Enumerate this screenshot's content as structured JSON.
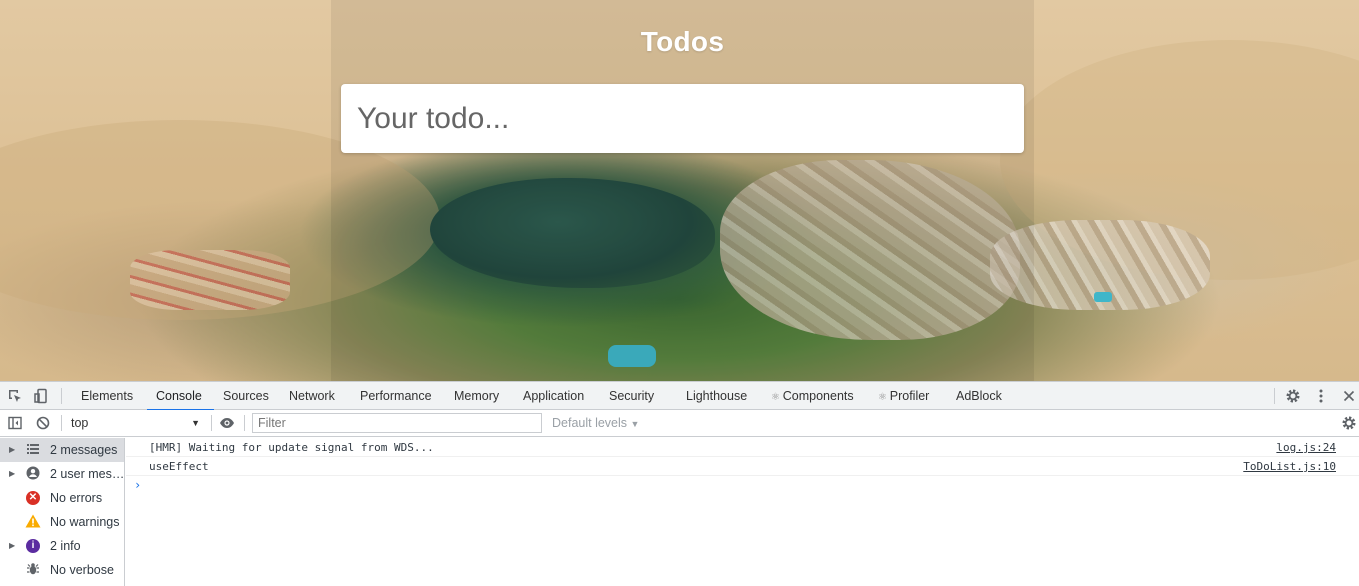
{
  "app": {
    "title": "Todos",
    "input_placeholder": "Your todo..."
  },
  "devtools": {
    "tabs": [
      "Elements",
      "Console",
      "Sources",
      "Network",
      "Performance",
      "Memory",
      "Application",
      "Security",
      "Lighthouse",
      "Components",
      "Profiler",
      "AdBlock"
    ],
    "active_tab": "Console",
    "toolbar": {
      "context": "top",
      "filter_placeholder": "Filter",
      "levels": "Default levels"
    },
    "sidebar": [
      {
        "label": "2 messages",
        "icon": "list-icon",
        "expandable": true,
        "selected": true
      },
      {
        "label": "2 user mes…",
        "icon": "user-icon",
        "expandable": true,
        "selected": false
      },
      {
        "label": "No errors",
        "icon": "error-icon",
        "expandable": false,
        "selected": false
      },
      {
        "label": "No warnings",
        "icon": "warning-icon",
        "expandable": false,
        "selected": false
      },
      {
        "label": "2 info",
        "icon": "info-icon",
        "expandable": true,
        "selected": false
      },
      {
        "label": "No verbose",
        "icon": "bug-icon",
        "expandable": false,
        "selected": false
      }
    ],
    "logs": [
      {
        "message": "[HMR] Waiting for update signal from WDS...",
        "source": "log.js:24"
      },
      {
        "message": "useEffect",
        "source": "ToDoList.js:10"
      }
    ],
    "prompt": "›"
  },
  "colors": {
    "accent": "#1a73e8",
    "error": "#d93025",
    "warning": "#f9ab00",
    "info": "#5b2ca0"
  }
}
